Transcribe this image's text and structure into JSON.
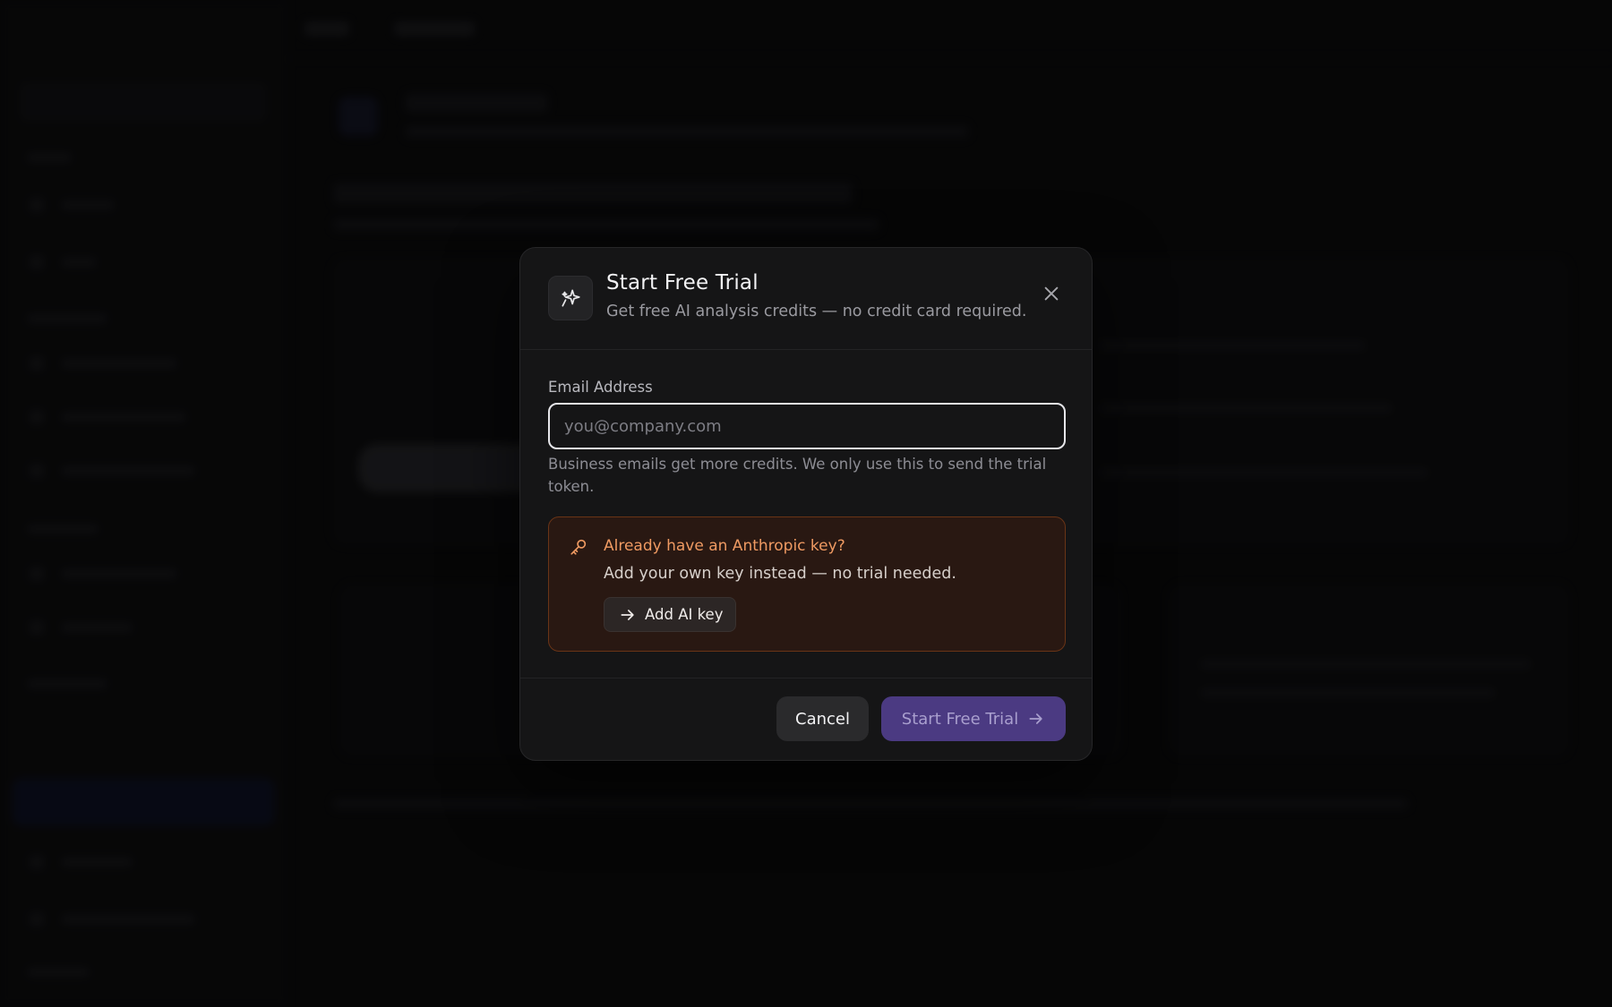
{
  "modal": {
    "title": "Start Free Trial",
    "subtitle": "Get free AI analysis credits — no credit card required.",
    "email_label": "Email Address",
    "email_value": "",
    "email_placeholder": "you@company.com",
    "email_help": "Business emails get more credits. We only use this to send the trial token.",
    "key_callout": {
      "title": "Already have an Anthropic key?",
      "text": "Add your own key instead — no trial needed.",
      "button_label": "Add AI key"
    },
    "footer": {
      "cancel_label": "Cancel",
      "submit_label": "Start Free Trial"
    }
  },
  "colors": {
    "accent_purple": "#4b3a82",
    "callout_orange": "#ef9a62",
    "callout_border": "#6a3416",
    "callout_bg": "#291812"
  },
  "icons": {
    "header": "sparkle-icon",
    "close": "close-icon",
    "key": "key-icon",
    "add_key": "arrow-right-icon",
    "submit": "arrow-right-icon"
  }
}
